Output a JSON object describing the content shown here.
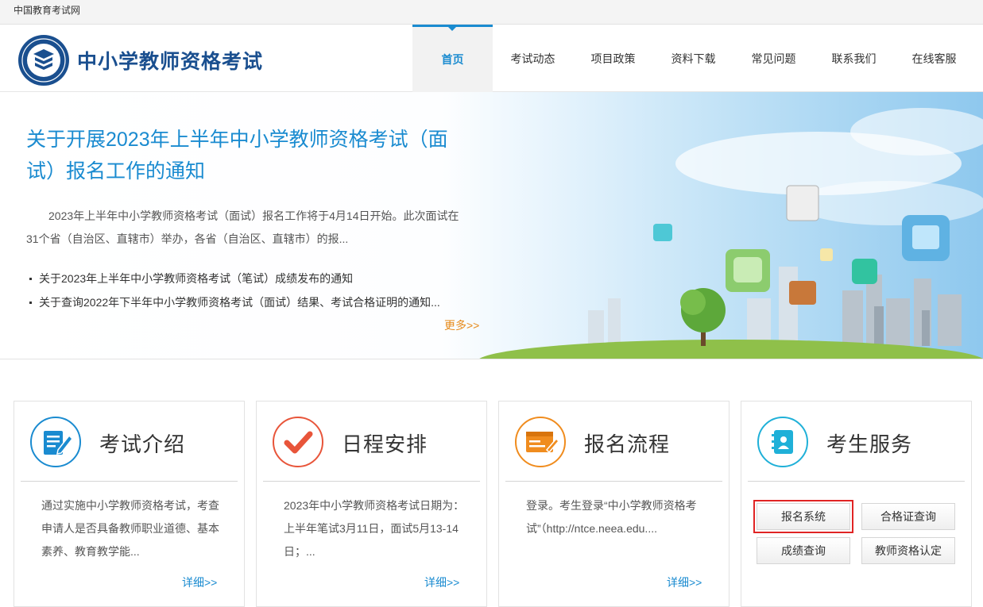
{
  "topbar": {
    "site_name": "中国教育考试网"
  },
  "header": {
    "brand": "中小学教师资格考试",
    "nav": [
      "首页",
      "考试动态",
      "项目政策",
      "资料下载",
      "常见问题",
      "联系我们",
      "在线客服"
    ],
    "active_nav": "首页"
  },
  "banner": {
    "title": "关于开展2023年上半年中小学教师资格考试（面试）报名工作的通知",
    "desc": "2023年上半年中小学教师资格考试（面试）报名工作将于4月14日开始。此次面试在31个省（自治区、直辖市）举办，各省（自治区、直辖市）的报...",
    "news": [
      "关于2023年上半年中小学教师资格考试（笔试）成绩发布的通知",
      "关于查询2022年下半年中小学教师资格考试（面试）结果、考试合格证明的通知..."
    ],
    "more": "更多>>"
  },
  "cards": [
    {
      "title": "考试介绍",
      "text": "通过实施中小学教师资格考试，考查申请人是否具备教师职业道德、基本素养、教育教学能...",
      "more": "详细>>",
      "icon": "document-pen-icon",
      "color": "#1a8bd0"
    },
    {
      "title": "日程安排",
      "text": "2023年中小学教师资格考试日期为：上半年笔试3月11日，面试5月13-14日；...",
      "more": "详细>>",
      "icon": "checkmark-icon",
      "color": "#e8553a"
    },
    {
      "title": "报名流程",
      "text": "登录。考生登录“中小学教师资格考试”（http://ntce.neea.edu....",
      "more": "详细>>",
      "icon": "form-edit-icon",
      "color": "#f08c1e"
    },
    {
      "title": "考生服务",
      "icon": "contact-book-icon",
      "color": "#1fb0d8"
    }
  ],
  "services": [
    "报名系统",
    "合格证查询",
    "成绩查询",
    "教师资格认定"
  ],
  "highlighted_service": "报名系统"
}
